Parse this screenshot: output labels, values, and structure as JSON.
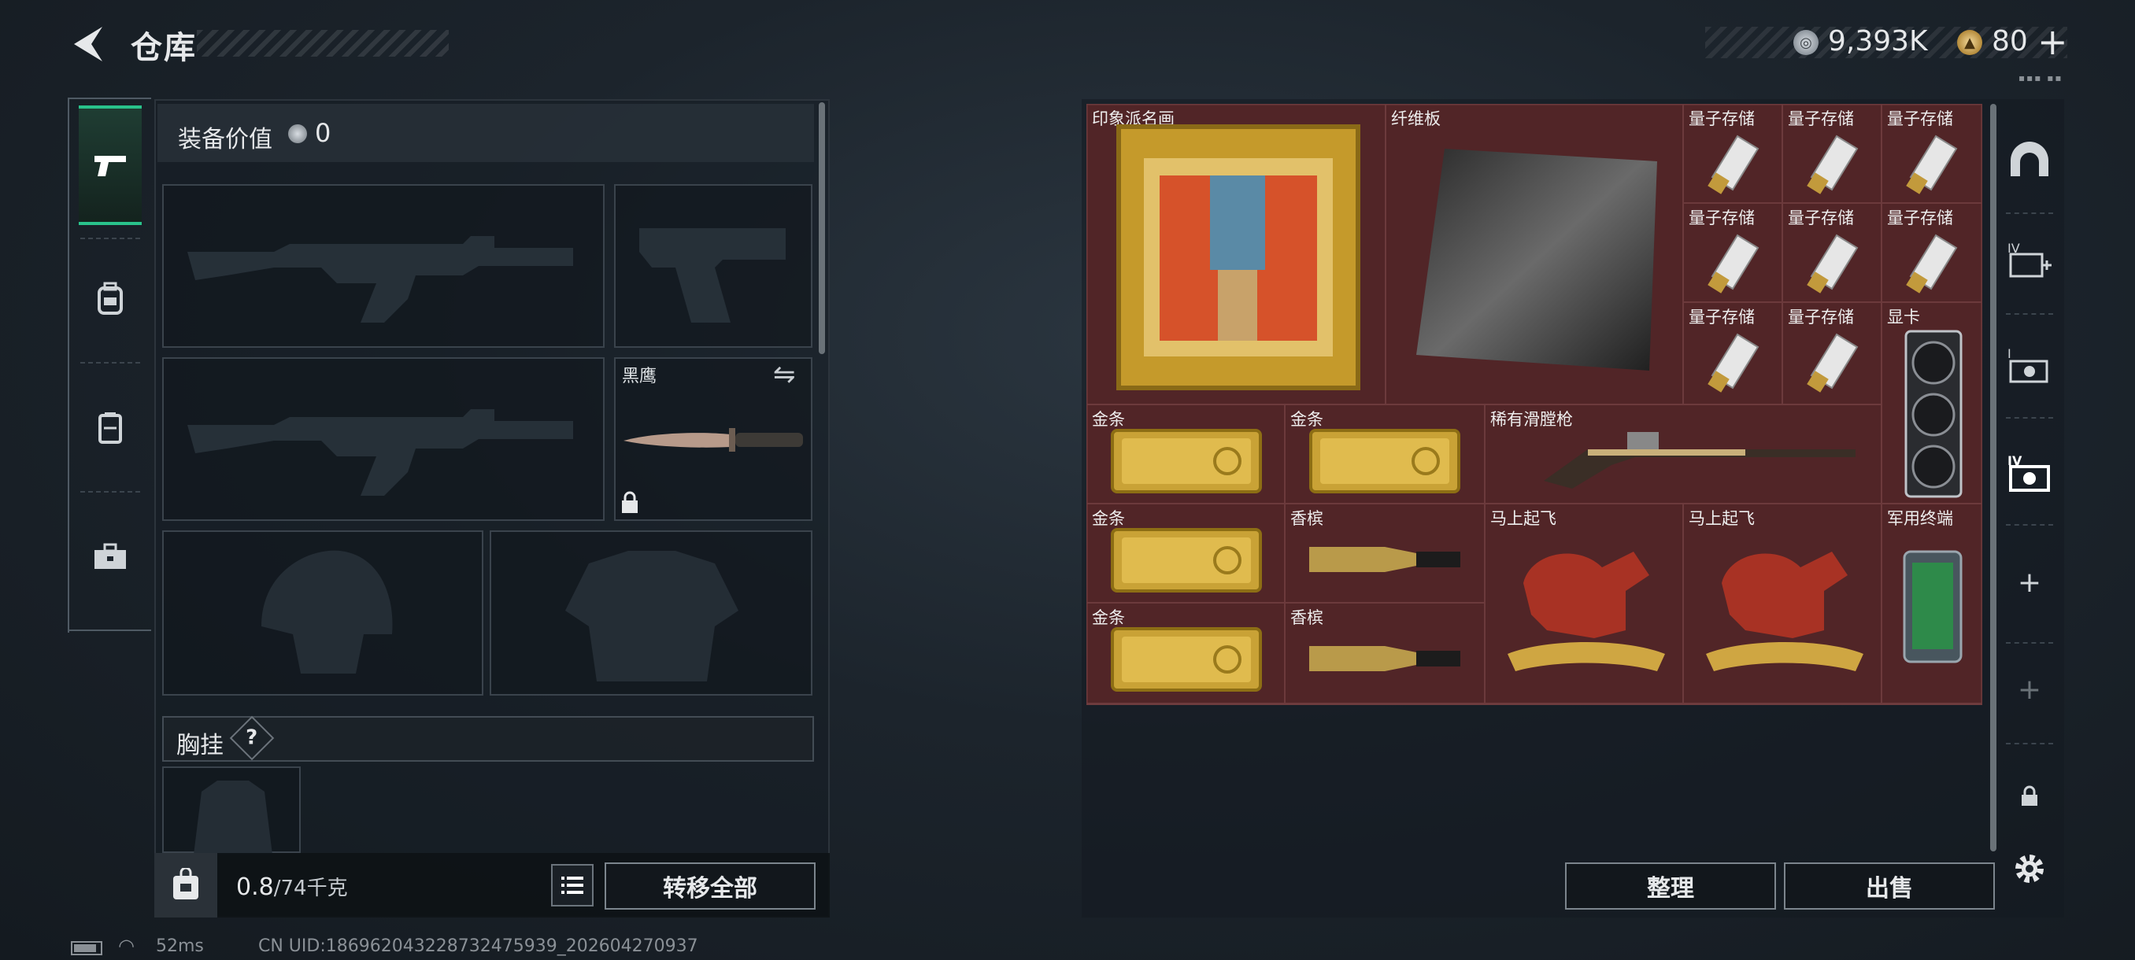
{
  "header": {
    "title": "仓库"
  },
  "currency": {
    "silver": "9,393K",
    "gold": "80",
    "add_label": "+"
  },
  "equipment": {
    "value_label": "装备价值",
    "value": "0"
  },
  "loadout": {
    "melee_slot_name": "黑鹰",
    "chest_rig_label": "胸挂",
    "help_label": "?"
  },
  "bag": {
    "weight_value": "0.8",
    "weight_unit": "/74千克"
  },
  "buttons": {
    "transfer_all": "转移全部",
    "sort": "整理",
    "sell": "出售"
  },
  "stash_items": {
    "painting": "印象派名画",
    "fiber_board": "纤维板",
    "quantum": [
      "量子存储",
      "量子存储",
      "量子存储",
      "量子存储",
      "量子存储",
      "量子存储",
      "量子存储",
      "量子存储"
    ],
    "gpu": "显卡",
    "gold": [
      "金条",
      "金条",
      "金条",
      "金条"
    ],
    "musket": "稀有滑膛枪",
    "champagne": [
      "香槟",
      "香槟"
    ],
    "horse": [
      "马上起飞",
      "马上起飞"
    ],
    "terminal": "军用终端"
  },
  "side_tabs": {
    "add_label": "+"
  },
  "status": {
    "ping": "52ms",
    "uid": "CN UID:186962043228732475939_202604270937"
  },
  "colors": {
    "accent_green": "#29c28b",
    "stash_red": "#4a2526",
    "gold_item": "#c9a236"
  }
}
